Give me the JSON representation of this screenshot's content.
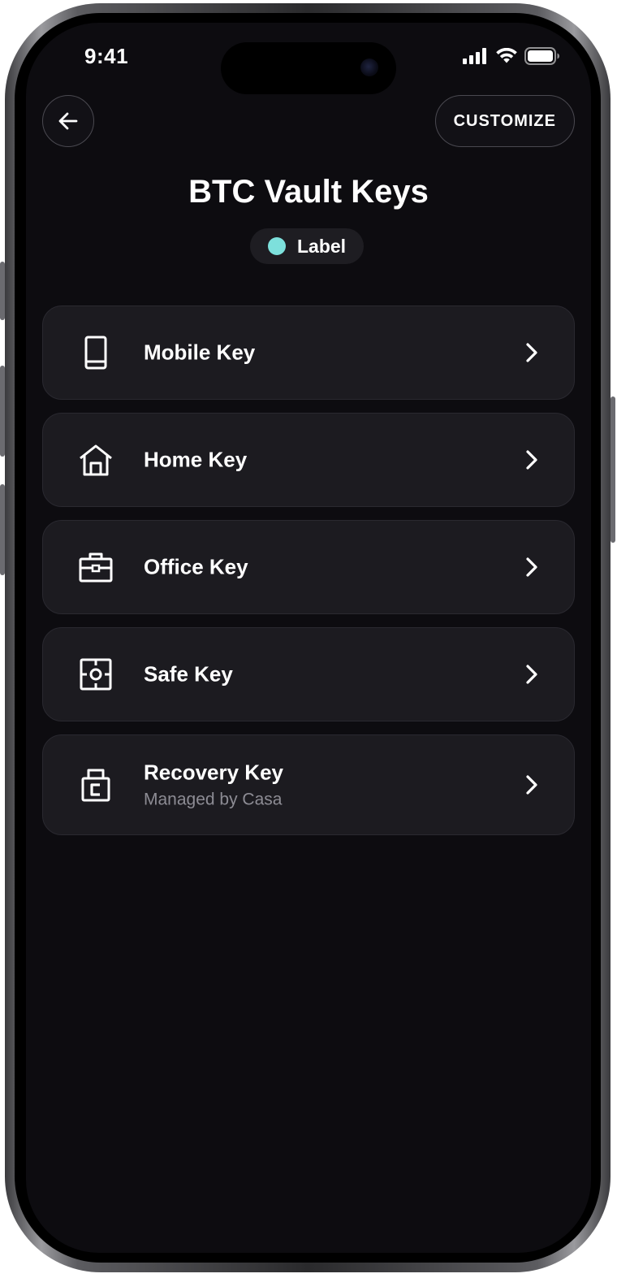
{
  "status_bar": {
    "time": "9:41"
  },
  "header": {
    "back_icon": "arrow-left-icon",
    "customize_label": "CUSTOMIZE"
  },
  "vault": {
    "title": "BTC Vault Keys",
    "label_text": "Label",
    "label_color": "#7de0dc"
  },
  "keys": [
    {
      "title": "Mobile Key",
      "subtitle": "",
      "icon": "smartphone-icon"
    },
    {
      "title": "Home Key",
      "subtitle": "",
      "icon": "house-icon"
    },
    {
      "title": "Office Key",
      "subtitle": "",
      "icon": "briefcase-icon"
    },
    {
      "title": "Safe Key",
      "subtitle": "",
      "icon": "safe-icon"
    },
    {
      "title": "Recovery Key",
      "subtitle": "Managed by Casa",
      "icon": "casa-lock-icon"
    }
  ],
  "colors": {
    "background": "#0d0c10",
    "card": "#1c1b20",
    "text_primary": "#ffffff",
    "text_secondary": "#8d8c94"
  }
}
